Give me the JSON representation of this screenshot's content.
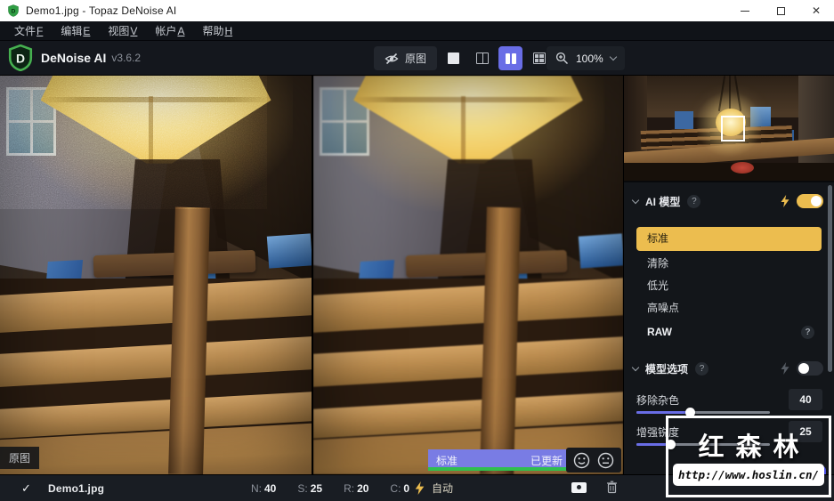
{
  "window": {
    "title": "Demo1.jpg - Topaz DeNoise AI",
    "controls": {
      "minimize": "minimize",
      "maximize": "maximize",
      "close": "close"
    }
  },
  "menu": {
    "items": [
      {
        "label": "文件",
        "hotkey": "F"
      },
      {
        "label": "编辑",
        "hotkey": "E"
      },
      {
        "label": "视图",
        "hotkey": "V"
      },
      {
        "label": "帐户",
        "hotkey": "A"
      },
      {
        "label": "帮助",
        "hotkey": "H"
      }
    ]
  },
  "toolbar": {
    "app_name": "DeNoise AI",
    "app_version": "v3.6.2",
    "original_button_label": "原图",
    "zoom_value": "100%"
  },
  "viewer": {
    "original_badge": "原图",
    "status_badge": {
      "model": "标准",
      "status": "已更新"
    }
  },
  "sidebar": {
    "ai_model_section": {
      "title": "AI 模型",
      "help": "?",
      "enabled": true
    },
    "models": [
      {
        "label": "标准",
        "selected": true
      },
      {
        "label": "清除",
        "selected": false
      },
      {
        "label": "低光",
        "selected": false
      },
      {
        "label": "高噪点",
        "selected": false
      },
      {
        "label": "RAW",
        "selected": false,
        "has_help": true
      }
    ],
    "model_options_section": {
      "title": "模型选项",
      "help": "?",
      "enabled": false,
      "sliders": [
        {
          "label": "移除杂色",
          "value": "40",
          "percent": 40
        },
        {
          "label": "增强锐度",
          "value": "25",
          "percent": 25
        }
      ]
    }
  },
  "bottom_bar": {
    "filename": "Demo1.jpg",
    "stats": [
      {
        "label": "N:",
        "value": "40"
      },
      {
        "label": "S:",
        "value": "25"
      },
      {
        "label": "R:",
        "value": "20"
      },
      {
        "label": "C:",
        "value": "0"
      }
    ],
    "auto_label": "自动"
  },
  "watermark": {
    "name": "红森林",
    "url": "http://www.hoslin.cn/"
  },
  "colors": {
    "accent_yellow": "#ecbd4f",
    "accent_purple": "#696de6",
    "apply_blue": "#4a4fe4",
    "progress_green": "#2fbf4f",
    "logo_green": "#3aa33f"
  }
}
